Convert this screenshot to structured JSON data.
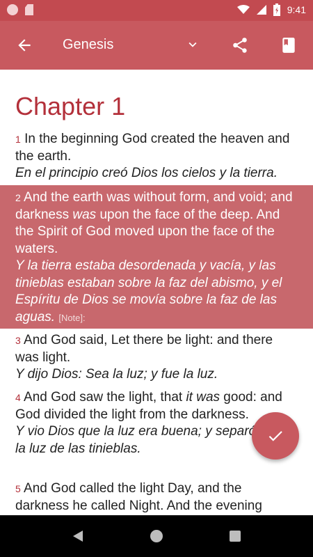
{
  "status": {
    "time": "9:41"
  },
  "appbar": {
    "title": "Genesis"
  },
  "chapter": {
    "title": "Chapter 1"
  },
  "verses": [
    {
      "num": "1",
      "en": "In the beginning God created the heaven and the earth.",
      "es": "En el principio creó Dios los cielos y la tierra."
    },
    {
      "num": "2",
      "en_a": "And the earth was without form, and void; and darkness ",
      "en_italic": "was",
      "en_b": " upon the face of the deep. And the Spirit of God moved upon the face of the waters.",
      "es": "Y la tierra estaba desordenada y vacía, y las tinieblas estaban sobre la faz del abismo, y el Espíritu de Dios se movía sobre la faz de las aguas.",
      "note": "[Note]:"
    },
    {
      "num": "3",
      "en": "And God said, Let there be light: and there was light.",
      "es": "Y dijo Dios: Sea la luz; y fue la luz."
    },
    {
      "num": "4",
      "en_a": "And God saw the light, that ",
      "en_italic": "it was",
      "en_b": " good: and God divided the light from the darkness.",
      "es": "Y vio Dios que la luz era buena; y separó Dios la luz de las tinieblas."
    },
    {
      "num": "5",
      "en": "And God called the light Day, and the darkness he called Night. And the evening"
    }
  ],
  "colors": {
    "primary": "#c8595f",
    "status": "#c24a50",
    "highlight": "#c8686d",
    "accent_text": "#b3303a"
  }
}
